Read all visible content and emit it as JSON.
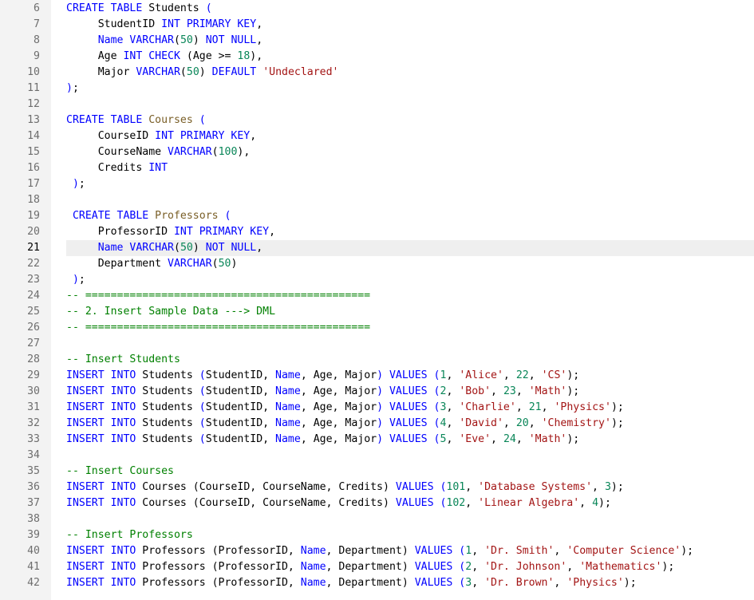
{
  "editor": {
    "active_line": 21,
    "colors": {
      "keyword": "#0000ff",
      "string": "#a31515",
      "number": "#098658",
      "comment": "#008000",
      "gutter_bg": "#f3f3f3",
      "active_line_bg": "#efefef"
    },
    "lines": [
      {
        "n": "6",
        "tokens": [
          [
            "kw",
            "CREATE TABLE "
          ],
          [
            "pn",
            "Students "
          ],
          [
            "kw",
            "("
          ]
        ]
      },
      {
        "n": "7",
        "tokens": [
          [
            "pn",
            "     StudentID "
          ],
          [
            "kw",
            "INT PRIMARY KEY"
          ],
          [
            "pn",
            ","
          ]
        ]
      },
      {
        "n": "8",
        "tokens": [
          [
            "pn",
            "     "
          ],
          [
            "kw",
            "Name VARCHAR"
          ],
          [
            "pn",
            "("
          ],
          [
            "num",
            "50"
          ],
          [
            "pn",
            ") "
          ],
          [
            "kw",
            "NOT NULL"
          ],
          [
            "pn",
            ","
          ]
        ]
      },
      {
        "n": "9",
        "tokens": [
          [
            "pn",
            "     Age "
          ],
          [
            "kw",
            "INT CHECK "
          ],
          [
            "pn",
            "(Age >= "
          ],
          [
            "num",
            "18"
          ],
          [
            "pn",
            "),"
          ]
        ]
      },
      {
        "n": "10",
        "tokens": [
          [
            "pn",
            "     Major "
          ],
          [
            "kw",
            "VARCHAR"
          ],
          [
            "pn",
            "("
          ],
          [
            "num",
            "50"
          ],
          [
            "pn",
            ") "
          ],
          [
            "kw",
            "DEFAULT "
          ],
          [
            "str",
            "'Undeclared'"
          ]
        ]
      },
      {
        "n": "11",
        "tokens": [
          [
            "kw",
            ")"
          ],
          [
            "pn",
            ";"
          ]
        ]
      },
      {
        "n": "12",
        "tokens": []
      },
      {
        "n": "13",
        "tokens": [
          [
            "kw",
            "CREATE TABLE "
          ],
          [
            "tbl",
            "Courses "
          ],
          [
            "kw",
            "("
          ]
        ]
      },
      {
        "n": "14",
        "tokens": [
          [
            "pn",
            "     CourseID "
          ],
          [
            "kw",
            "INT PRIMARY KEY"
          ],
          [
            "pn",
            ","
          ]
        ]
      },
      {
        "n": "15",
        "tokens": [
          [
            "pn",
            "     CourseName "
          ],
          [
            "kw",
            "VARCHAR"
          ],
          [
            "pn",
            "("
          ],
          [
            "num",
            "100"
          ],
          [
            "pn",
            "),"
          ]
        ]
      },
      {
        "n": "16",
        "tokens": [
          [
            "pn",
            "     Credits "
          ],
          [
            "kw",
            "INT"
          ]
        ]
      },
      {
        "n": "17",
        "tokens": [
          [
            "pn",
            " "
          ],
          [
            "kw",
            ")"
          ],
          [
            "pn",
            ";"
          ]
        ]
      },
      {
        "n": "18",
        "tokens": []
      },
      {
        "n": "19",
        "tokens": [
          [
            "pn",
            " "
          ],
          [
            "kw",
            "CREATE TABLE "
          ],
          [
            "tbl",
            "Professors "
          ],
          [
            "kw",
            "("
          ]
        ]
      },
      {
        "n": "20",
        "tokens": [
          [
            "pn",
            "     ProfessorID "
          ],
          [
            "kw",
            "INT PRIMARY KEY"
          ],
          [
            "pn",
            ","
          ]
        ]
      },
      {
        "n": "21",
        "tokens": [
          [
            "pn",
            "     "
          ],
          [
            "kw",
            "Name VARCHAR"
          ],
          [
            "pn",
            "("
          ],
          [
            "num",
            "50"
          ],
          [
            "pn",
            ") "
          ],
          [
            "kw",
            "NOT NULL"
          ],
          [
            "pn",
            ","
          ]
        ]
      },
      {
        "n": "22",
        "tokens": [
          [
            "pn",
            "     Department "
          ],
          [
            "kw",
            "VARCHAR"
          ],
          [
            "pn",
            "("
          ],
          [
            "num",
            "50"
          ],
          [
            "pn",
            ")"
          ]
        ]
      },
      {
        "n": "23",
        "tokens": [
          [
            "pn",
            " "
          ],
          [
            "kw",
            ")"
          ],
          [
            "pn",
            ";"
          ]
        ]
      },
      {
        "n": "24",
        "tokens": [
          [
            "cm",
            "-- ============================================="
          ]
        ]
      },
      {
        "n": "25",
        "tokens": [
          [
            "cm",
            "-- 2. Insert Sample Data ---> DML"
          ]
        ]
      },
      {
        "n": "26",
        "tokens": [
          [
            "cm",
            "-- ============================================="
          ]
        ]
      },
      {
        "n": "27",
        "tokens": []
      },
      {
        "n": "28",
        "tokens": [
          [
            "cm",
            "-- Insert Students"
          ]
        ]
      },
      {
        "n": "29",
        "tokens": [
          [
            "kw",
            "INSERT INTO "
          ],
          [
            "pn",
            "Students "
          ],
          [
            "kw",
            "("
          ],
          [
            "pn",
            "StudentID, "
          ],
          [
            "kw",
            "Name"
          ],
          [
            "pn",
            ", Age, Major"
          ],
          [
            "kw",
            ") VALUES ("
          ],
          [
            "num",
            "1"
          ],
          [
            "pn",
            ", "
          ],
          [
            "str",
            "'Alice'"
          ],
          [
            "pn",
            ", "
          ],
          [
            "num",
            "22"
          ],
          [
            "pn",
            ", "
          ],
          [
            "str",
            "'CS'"
          ],
          [
            "pn",
            ");"
          ]
        ]
      },
      {
        "n": "30",
        "tokens": [
          [
            "kw",
            "INSERT INTO "
          ],
          [
            "pn",
            "Students "
          ],
          [
            "kw",
            "("
          ],
          [
            "pn",
            "StudentID, "
          ],
          [
            "kw",
            "Name"
          ],
          [
            "pn",
            ", Age, Major"
          ],
          [
            "kw",
            ") VALUES ("
          ],
          [
            "num",
            "2"
          ],
          [
            "pn",
            ", "
          ],
          [
            "str",
            "'Bob'"
          ],
          [
            "pn",
            ", "
          ],
          [
            "num",
            "23"
          ],
          [
            "pn",
            ", "
          ],
          [
            "str",
            "'Math'"
          ],
          [
            "pn",
            ");"
          ]
        ]
      },
      {
        "n": "31",
        "tokens": [
          [
            "kw",
            "INSERT INTO "
          ],
          [
            "pn",
            "Students "
          ],
          [
            "kw",
            "("
          ],
          [
            "pn",
            "StudentID, "
          ],
          [
            "kw",
            "Name"
          ],
          [
            "pn",
            ", Age, Major"
          ],
          [
            "kw",
            ") VALUES ("
          ],
          [
            "num",
            "3"
          ],
          [
            "pn",
            ", "
          ],
          [
            "str",
            "'Charlie'"
          ],
          [
            "pn",
            ", "
          ],
          [
            "num",
            "21"
          ],
          [
            "pn",
            ", "
          ],
          [
            "str",
            "'Physics'"
          ],
          [
            "pn",
            ");"
          ]
        ]
      },
      {
        "n": "32",
        "tokens": [
          [
            "kw",
            "INSERT INTO "
          ],
          [
            "pn",
            "Students "
          ],
          [
            "kw",
            "("
          ],
          [
            "pn",
            "StudentID, "
          ],
          [
            "kw",
            "Name"
          ],
          [
            "pn",
            ", Age, Major"
          ],
          [
            "kw",
            ") VALUES ("
          ],
          [
            "num",
            "4"
          ],
          [
            "pn",
            ", "
          ],
          [
            "str",
            "'David'"
          ],
          [
            "pn",
            ", "
          ],
          [
            "num",
            "20"
          ],
          [
            "pn",
            ", "
          ],
          [
            "str",
            "'Chemistry'"
          ],
          [
            "pn",
            ");"
          ]
        ]
      },
      {
        "n": "33",
        "tokens": [
          [
            "kw",
            "INSERT INTO "
          ],
          [
            "pn",
            "Students "
          ],
          [
            "kw",
            "("
          ],
          [
            "pn",
            "StudentID, "
          ],
          [
            "kw",
            "Name"
          ],
          [
            "pn",
            ", Age, Major"
          ],
          [
            "kw",
            ") VALUES ("
          ],
          [
            "num",
            "5"
          ],
          [
            "pn",
            ", "
          ],
          [
            "str",
            "'Eve'"
          ],
          [
            "pn",
            ", "
          ],
          [
            "num",
            "24"
          ],
          [
            "pn",
            ", "
          ],
          [
            "str",
            "'Math'"
          ],
          [
            "pn",
            ");"
          ]
        ]
      },
      {
        "n": "34",
        "tokens": []
      },
      {
        "n": "35",
        "tokens": [
          [
            "cm",
            "-- Insert Courses"
          ]
        ]
      },
      {
        "n": "36",
        "tokens": [
          [
            "kw",
            "INSERT INTO "
          ],
          [
            "pn",
            "Courses (CourseID, CourseName, Credits) "
          ],
          [
            "kw",
            "VALUES ("
          ],
          [
            "num",
            "101"
          ],
          [
            "pn",
            ", "
          ],
          [
            "str",
            "'Database Systems'"
          ],
          [
            "pn",
            ", "
          ],
          [
            "num",
            "3"
          ],
          [
            "pn",
            ");"
          ]
        ]
      },
      {
        "n": "37",
        "tokens": [
          [
            "kw",
            "INSERT INTO "
          ],
          [
            "pn",
            "Courses (CourseID, CourseName, Credits) "
          ],
          [
            "kw",
            "VALUES ("
          ],
          [
            "num",
            "102"
          ],
          [
            "pn",
            ", "
          ],
          [
            "str",
            "'Linear Algebra'"
          ],
          [
            "pn",
            ", "
          ],
          [
            "num",
            "4"
          ],
          [
            "pn",
            ");"
          ]
        ]
      },
      {
        "n": "38",
        "tokens": []
      },
      {
        "n": "39",
        "tokens": [
          [
            "cm",
            "-- Insert Professors"
          ]
        ]
      },
      {
        "n": "40",
        "tokens": [
          [
            "kw",
            "INSERT INTO "
          ],
          [
            "pn",
            "Professors (ProfessorID, "
          ],
          [
            "kw",
            "Name"
          ],
          [
            "pn",
            ", Department) "
          ],
          [
            "kw",
            "VALUES ("
          ],
          [
            "num",
            "1"
          ],
          [
            "pn",
            ", "
          ],
          [
            "str",
            "'Dr. Smith'"
          ],
          [
            "pn",
            ", "
          ],
          [
            "str",
            "'Computer Science'"
          ],
          [
            "pn",
            ");"
          ]
        ]
      },
      {
        "n": "41",
        "tokens": [
          [
            "kw",
            "INSERT INTO "
          ],
          [
            "pn",
            "Professors (ProfessorID, "
          ],
          [
            "kw",
            "Name"
          ],
          [
            "pn",
            ", Department) "
          ],
          [
            "kw",
            "VALUES ("
          ],
          [
            "num",
            "2"
          ],
          [
            "pn",
            ", "
          ],
          [
            "str",
            "'Dr. Johnson'"
          ],
          [
            "pn",
            ", "
          ],
          [
            "str",
            "'Mathematics'"
          ],
          [
            "pn",
            ");"
          ]
        ]
      },
      {
        "n": "42",
        "tokens": [
          [
            "kw",
            "INSERT INTO "
          ],
          [
            "pn",
            "Professors (ProfessorID, "
          ],
          [
            "kw",
            "Name"
          ],
          [
            "pn",
            ", Department) "
          ],
          [
            "kw",
            "VALUES ("
          ],
          [
            "num",
            "3"
          ],
          [
            "pn",
            ", "
          ],
          [
            "str",
            "'Dr. Brown'"
          ],
          [
            "pn",
            ", "
          ],
          [
            "str",
            "'Physics'"
          ],
          [
            "pn",
            ");"
          ]
        ]
      }
    ]
  }
}
